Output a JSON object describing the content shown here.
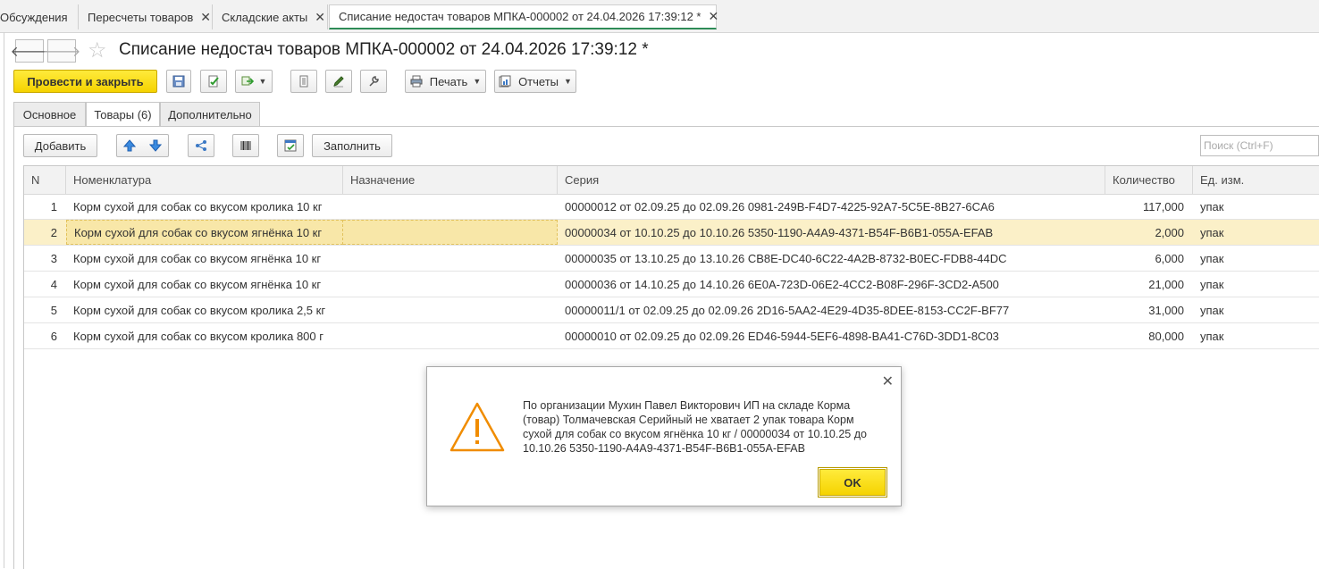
{
  "top_tabs": [
    {
      "label": "Обсуждения",
      "closable": false
    },
    {
      "label": "Пересчеты товаров",
      "closable": true
    },
    {
      "label": "Складские акты",
      "closable": true
    },
    {
      "label": "Списание недостач товаров МПКА-000002 от 24.04.2026 17:39:12 *",
      "closable": true,
      "active": true
    }
  ],
  "close_glyph": "✕",
  "header": {
    "title": "Списание недостач товаров МПКА-000002 от 24.04.2026 17:39:12 *",
    "back_glyph": "🡐",
    "forward_glyph": "🡒",
    "star_glyph": "☆"
  },
  "toolbar": {
    "post_close": "Провести и закрыть",
    "print": "Печать",
    "reports": "Отчеты"
  },
  "form_tabs": [
    "Основное",
    "Товары (6)",
    "Дополнительно"
  ],
  "table_toolbar": {
    "add": "Добавить",
    "fill": "Заполнить",
    "search_placeholder": "Поиск (Ctrl+F)"
  },
  "table": {
    "columns": [
      "N",
      "Номенклатура",
      "Назначение",
      "Серия",
      "Количество",
      "Ед. изм."
    ],
    "rows": [
      {
        "n": "1",
        "item": "Корм сухой для собак со вкусом кролика 10 кг",
        "purpose": "",
        "series": "00000012 от 02.09.25 до 02.09.26 0981-249B-F4D7-4225-92A7-5C5E-8B27-6CA6",
        "qty": "117,000",
        "unit": "упак"
      },
      {
        "n": "2",
        "item": "Корм сухой для собак со вкусом ягнёнка 10 кг",
        "purpose": "",
        "series": "00000034 от 10.10.25 до 10.10.26 5350-1190-A4A9-4371-B54F-B6B1-055A-EFAB",
        "qty": "2,000",
        "unit": "упак",
        "selected": true
      },
      {
        "n": "3",
        "item": "Корм сухой для собак со вкусом ягнёнка 10 кг",
        "purpose": "",
        "series": "00000035 от 13.10.25 до 13.10.26 CB8E-DC40-6C22-4A2B-8732-B0EC-FDB8-44DC",
        "qty": "6,000",
        "unit": "упак"
      },
      {
        "n": "4",
        "item": "Корм сухой для собак со вкусом ягнёнка 10 кг",
        "purpose": "",
        "series": "00000036 от 14.10.25 до 14.10.26 6E0A-723D-06E2-4CC2-B08F-296F-3CD2-A500",
        "qty": "21,000",
        "unit": "упак"
      },
      {
        "n": "5",
        "item": "Корм сухой для собак со вкусом кролика 2,5 кг",
        "purpose": "",
        "series": "00000011/1 от 02.09.25 до 02.09.26 2D16-5AA2-4E29-4D35-8DEE-8153-CC2F-BF77",
        "qty": "31,000",
        "unit": "упак"
      },
      {
        "n": "6",
        "item": "Корм сухой для собак со вкусом кролика 800 г",
        "purpose": "",
        "series": "00000010 от 02.09.25 до 02.09.26 ED46-5944-5EF6-4898-BA41-C76D-3DD1-8C03",
        "qty": "80,000",
        "unit": "упак"
      }
    ]
  },
  "dialog": {
    "message": "По организации Мухин Павел Викторович ИП на складе Корма (товар) Толмачевская Серийный не хватает 2 упак товара Корм сухой для собак со вкусом ягнёнка 10 кг / 00000034 от 10.10.25 до 10.10.26 5350-1190-A4A9-4371-B54F-B6B1-055A-EFAB",
    "ok": "OK",
    "close_glyph": "✕",
    "icon": "warning-icon"
  },
  "colors": {
    "accent_yellow": "#f5d300",
    "selected_row": "#fbf0c8",
    "active_tab_underline": "#2e8b57",
    "warning_orange": "#f08c00"
  }
}
